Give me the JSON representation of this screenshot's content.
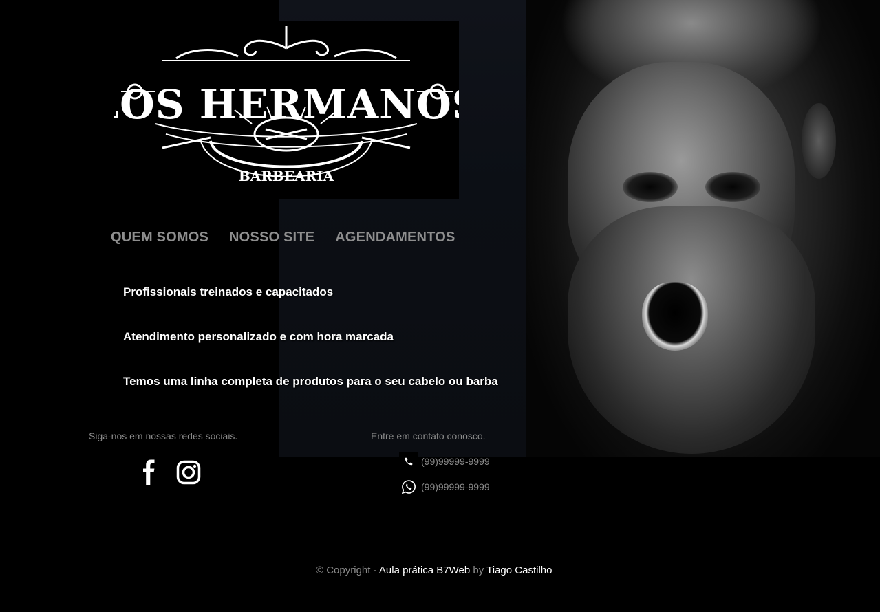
{
  "logo": {
    "name": "LOS HERMANOS",
    "subtitle": "BARBEARIA"
  },
  "nav": {
    "items": [
      {
        "label": "QUEM SOMOS"
      },
      {
        "label": "NOSSO SITE"
      },
      {
        "label": "AGENDAMENTOS"
      }
    ]
  },
  "features": [
    {
      "text": "Profissionais treinados e capacitados"
    },
    {
      "text": "Atendimento personalizado e com hora marcada"
    },
    {
      "text": "Temos uma linha completa de produtos para o seu cabelo ou barba"
    }
  ],
  "social": {
    "title": "Siga-nos em nossas redes sociais.",
    "icons": [
      "facebook-icon",
      "instagram-icon"
    ]
  },
  "contact": {
    "title": "Entre em contato conosco.",
    "phone": "(99)99999-9999",
    "whatsapp": "(99)99999-9999"
  },
  "footer": {
    "prefix": "© Copyright - ",
    "course_link": "Aula prática B7Web",
    "by": " by ",
    "author_link": "Tiago Castilho"
  },
  "colors": {
    "background": "#000000",
    "nav_text": "#8e8e8e",
    "muted_text": "#8a8a8a",
    "accent_text": "#ffffff"
  }
}
